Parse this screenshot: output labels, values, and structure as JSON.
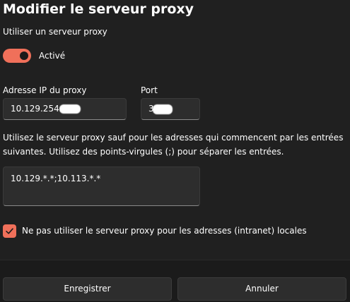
{
  "dialog": {
    "title": "Modifier le serveur proxy",
    "use_proxy_label": "Utiliser un serveur proxy",
    "toggle": {
      "state_label": "Activé",
      "on": true,
      "accent_color": "#f0705a"
    },
    "ip_field": {
      "label": "Adresse IP du proxy",
      "value": "10.129.254."
    },
    "port_field": {
      "label": "Port",
      "value": "3"
    },
    "exceptions": {
      "description": "Utilisez le serveur proxy sauf pour les adresses qui commencent par les entrées suivantes. Utilisez des points-virgules (;) pour séparer les entrées.",
      "value": "10.129.*.*;10.113.*.*"
    },
    "local_bypass": {
      "label": "Ne pas utiliser le serveur proxy pour les adresses (intranet) locales",
      "checked": true
    },
    "buttons": {
      "save_label": "Enregistrer",
      "cancel_label": "Annuler"
    }
  }
}
